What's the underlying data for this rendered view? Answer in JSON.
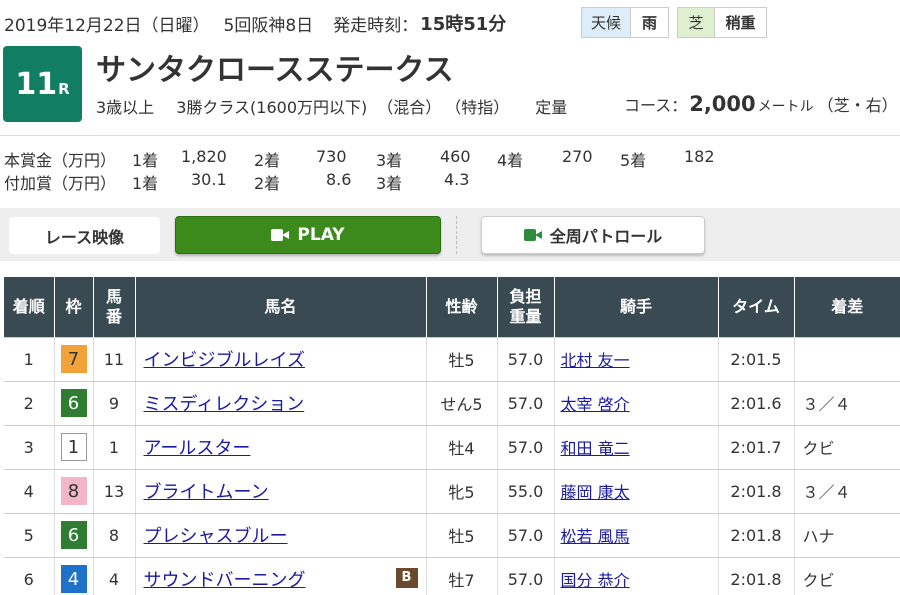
{
  "header": {
    "date": "2019年12月22日（日曜）",
    "meeting": "5回阪神8日",
    "post_time_label": "発走時刻：",
    "post_time": "15時51分",
    "weather_label": "天候",
    "weather": "雨",
    "track_label": "芝",
    "track_condition": "稍重"
  },
  "race": {
    "number": "11",
    "number_suffix": "R",
    "title": "サンタクロースステークス",
    "age": "3歳以上",
    "class": "3勝クラス(1600万円以下)",
    "mix": "（混合）",
    "designation": "（特指）",
    "weight_rule": "定量",
    "course_label": "コース：",
    "distance": "2,000",
    "distance_unit": "メートル",
    "surface": "（芝・右）"
  },
  "prize": {
    "main_label": "本賞金（万円）",
    "main": [
      {
        "place": "1着",
        "amount": "1,820"
      },
      {
        "place": "2着",
        "amount": "730"
      },
      {
        "place": "3着",
        "amount": "460"
      },
      {
        "place": "4着",
        "amount": "270"
      },
      {
        "place": "5着",
        "amount": "182"
      }
    ],
    "extra_label": "付加賞（万円）",
    "extra": [
      {
        "place": "1着",
        "amount": "30.1"
      },
      {
        "place": "2着",
        "amount": "8.6"
      },
      {
        "place": "3着",
        "amount": "4.3"
      }
    ]
  },
  "buttons": {
    "video_label": "レース映像",
    "play_label": "PLAY",
    "patrol_label": "全周パトロール"
  },
  "table": {
    "headers": {
      "rank": "着順",
      "waku": "枠",
      "umaban_1": "馬",
      "umaban_2": "番",
      "horse": "馬名",
      "sex_age": "性齢",
      "weight_1": "負担",
      "weight_2": "重量",
      "jockey": "騎手",
      "time": "タイム",
      "margin": "着差"
    },
    "rows": [
      {
        "rank": "1",
        "waku": "7",
        "umaban": "11",
        "horse": "インビジブルレイズ",
        "sex_age": "牡5",
        "weight": "57.0",
        "jockey": "北村 友一",
        "time": "2:01.5",
        "margin": "",
        "blinker": ""
      },
      {
        "rank": "2",
        "waku": "6",
        "umaban": "9",
        "horse": "ミスディレクション",
        "sex_age": "せん5",
        "weight": "57.0",
        "jockey": "太宰 啓介",
        "time": "2:01.6",
        "margin": "３／４",
        "blinker": ""
      },
      {
        "rank": "3",
        "waku": "1",
        "umaban": "1",
        "horse": "アールスター",
        "sex_age": "牡4",
        "weight": "57.0",
        "jockey": "和田 竜二",
        "time": "2:01.7",
        "margin": "クビ",
        "blinker": ""
      },
      {
        "rank": "4",
        "waku": "8",
        "umaban": "13",
        "horse": "ブライトムーン",
        "sex_age": "牝5",
        "weight": "55.0",
        "jockey": "藤岡 康太",
        "time": "2:01.8",
        "margin": "３／４",
        "blinker": ""
      },
      {
        "rank": "5",
        "waku": "6",
        "umaban": "8",
        "horse": "プレシャスブルー",
        "sex_age": "牡5",
        "weight": "57.0",
        "jockey": "松若 風馬",
        "time": "2:01.8",
        "margin": "ハナ",
        "blinker": ""
      },
      {
        "rank": "6",
        "waku": "4",
        "umaban": "4",
        "horse": "サウンドバーニング",
        "sex_age": "牡7",
        "weight": "57.0",
        "jockey": "国分 恭介",
        "time": "2:01.8",
        "margin": "クビ",
        "blinker": "B"
      }
    ]
  },
  "colors": {
    "race_badge": "#117e63",
    "play_button": "#3d8a1c",
    "table_header": "#3a4a52",
    "link": "#1a1aa6",
    "waku": {
      "1": {
        "bg": "#ffffff",
        "fg": "#333333",
        "border": "#999999"
      },
      "4": {
        "bg": "#1e73c8",
        "fg": "#ffffff",
        "border": "#1e73c8"
      },
      "6": {
        "bg": "#2e7d32",
        "fg": "#ffffff",
        "border": "#2e7d32"
      },
      "7": {
        "bg": "#f3a23a",
        "fg": "#333333",
        "border": "#f3a23a"
      },
      "8": {
        "bg": "#f3b6c8",
        "fg": "#333333",
        "border": "#f3b6c8"
      }
    }
  }
}
